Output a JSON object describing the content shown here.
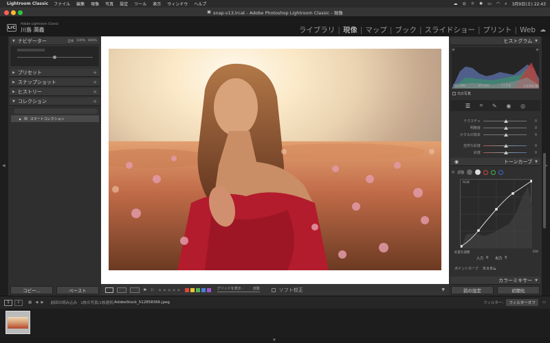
{
  "menubar": {
    "app_name": "Lightroom Classic",
    "menus": [
      "ファイル",
      "編集",
      "現像",
      "写真",
      "設定",
      "ツール",
      "表示",
      "ウィンドウ",
      "ヘルプ"
    ],
    "clock": "3月9日(土) 22:43"
  },
  "window": {
    "title": "snap-v13.lrcat - Adobe Photoshop Lightroom Classic - 現像"
  },
  "identity": {
    "brand_small": "Adobe Lightroom Classic",
    "user_name": "川島 潤義",
    "logo": "LrC"
  },
  "modules": [
    "ライブラリ",
    "現像",
    "マップ",
    "ブック",
    "スライドショー",
    "プリント",
    "Web"
  ],
  "active_module_index": 1,
  "left_panel": {
    "navigator": {
      "label": "ナビゲーター",
      "zoom_options": [
        "全体",
        "100%",
        "800%"
      ]
    },
    "presets": {
      "label": "プリセット"
    },
    "snapshots": {
      "label": "スナップショット"
    },
    "history": {
      "label": "ヒストリー"
    },
    "collections": {
      "label": "コレクション",
      "item": "スマートコレクション"
    },
    "copy_button": "コピー...",
    "paste_button": "ペースト"
  },
  "toolbar": {
    "flag_icons": [
      "flag",
      "reject"
    ],
    "stars": "★★★★★",
    "color_labels": [
      "#e0463c",
      "#e8c531",
      "#56b452",
      "#4b7fd6",
      "#9b56c9"
    ],
    "grid_label": "グリッドを表示 :",
    "grid_value": "自動",
    "soft_proof": "ソフト校正"
  },
  "right_panel": {
    "histogram": {
      "label": "ヒストグラム",
      "iso": "ISO 200",
      "focal": "35 mm",
      "aperture": "f / 2.8",
      "shutter": "1/2500 秒",
      "original": "元の写真"
    },
    "basic_sliders": [
      {
        "label": "テクスチャ",
        "value": "0"
      },
      {
        "label": "明瞭度",
        "value": "0"
      },
      {
        "label": "かすみの除去",
        "value": "0"
      },
      {
        "label": "自然な彩度",
        "value": "0"
      },
      {
        "label": "彩度",
        "value": "0"
      }
    ],
    "tone_curve": {
      "label": "トーンカーブ",
      "adjust": "調整",
      "rgb_label": "RGB",
      "refine": "彩度を調整",
      "max": "100",
      "input_label": "入力",
      "input_val": "0",
      "output_label": "出力",
      "output_val": "5",
      "point_curve_label": "ポイントカーブ",
      "point_curve_value": "カスタム"
    },
    "color_mixer": {
      "label": "カラーミキサー"
    },
    "prev_button": "前の設定",
    "reset_button": "初期化"
  },
  "filmstrip": {
    "page1": "1",
    "page2": "2",
    "source": "前回の読み込み",
    "info": "1枚の写真/1枚選択/",
    "filename": "AdobeStock_512858366.jpeg",
    "filter_label": "フィルター:",
    "filter_value": "フィルターオフ"
  }
}
